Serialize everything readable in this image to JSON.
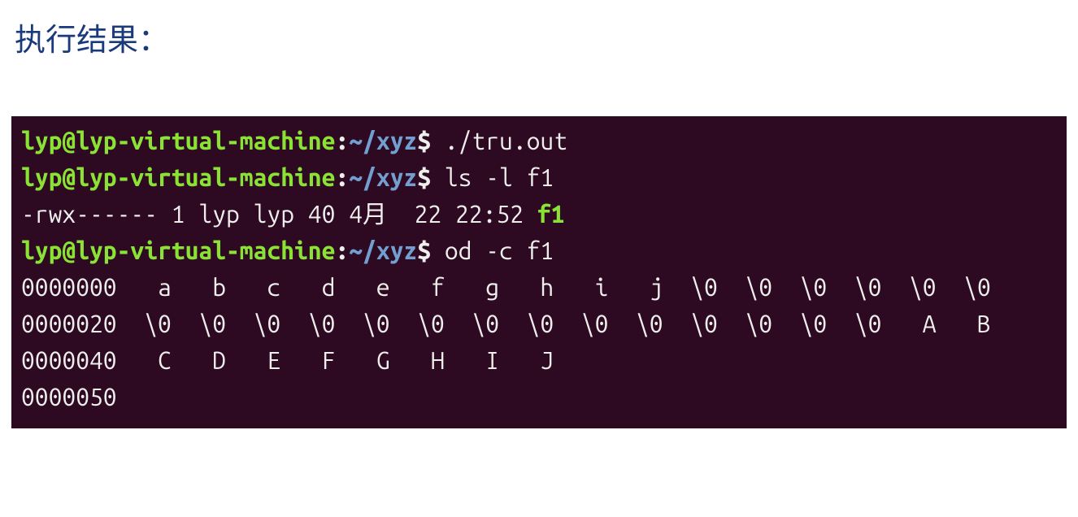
{
  "heading": "执行结果：",
  "prompt": {
    "userHost": "lyp@lyp-virtual-machine",
    "colon": ":",
    "path": "~/xyz",
    "dollar": "$"
  },
  "cmd1": " ./tru.out",
  "cmd2": " ls -l f1",
  "ls_output_prefix": "-rwx------ 1 lyp lyp 40 4月  22 22:52 ",
  "ls_output_fname": "f1",
  "cmd3": " od -c f1",
  "od_line1": "0000000   a   b   c   d   e   f   g   h   i   j  \\0  \\0  \\0  \\0  \\0  \\0",
  "od_line2": "0000020  \\0  \\0  \\0  \\0  \\0  \\0  \\0  \\0  \\0  \\0  \\0  \\0  \\0  \\0   A   B",
  "od_line3": "0000040   C   D   E   F   G   H   I   J",
  "od_line4": "0000050"
}
